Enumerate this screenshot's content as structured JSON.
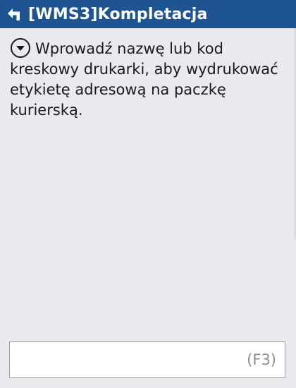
{
  "header": {
    "title": "[WMS3]Kompletacja",
    "back_icon": "back-arrow-icon"
  },
  "message": {
    "expand_icon": "chevron-down-circle-icon",
    "text": "Wprowadź nazwę lub kod kreskowy drukarki, aby wydrukować etykietę adresową na paczkę kurierską."
  },
  "input": {
    "value": "",
    "hint": "(F3)"
  },
  "colors": {
    "titlebar": "#1d5491",
    "background": "#e9eaed"
  }
}
